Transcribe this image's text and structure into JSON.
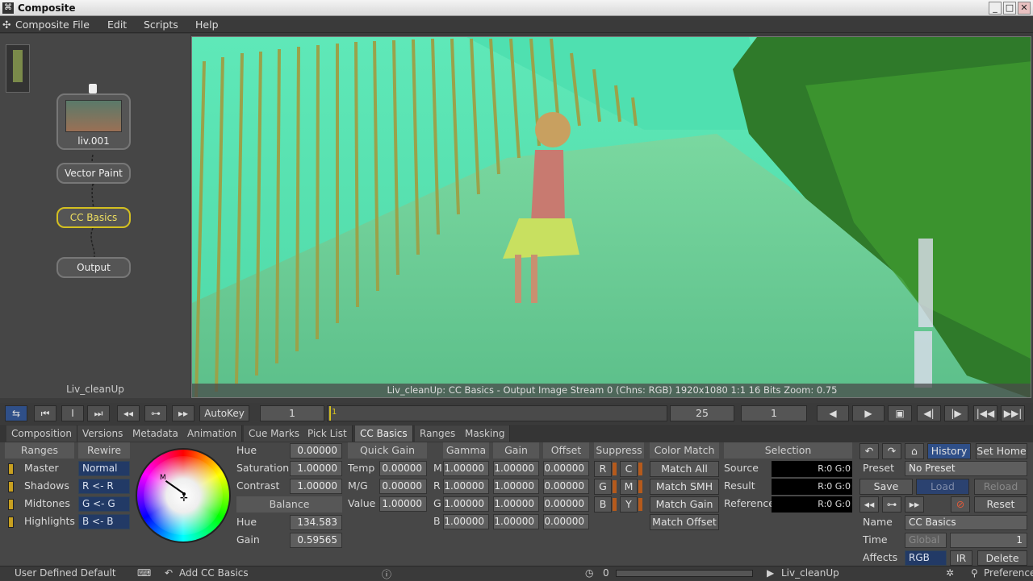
{
  "window": {
    "title": "Composite",
    "min": "_",
    "max": "□",
    "close": "✕"
  },
  "menu": {
    "app": "Composite",
    "items": [
      "File",
      "Edit",
      "Scripts",
      "Help"
    ]
  },
  "nodes": {
    "clip": "liv.001",
    "vector": "Vector Paint",
    "cc": "CC Basics",
    "output": "Output",
    "comp_name": "Liv_cleanUp"
  },
  "viewer": {
    "info": "Liv_cleanUp: CC Basics - Output Image  Stream 0 (Chns: RGB)  1920x1080  1:1  16 Bits  Zoom: 0.75"
  },
  "timeline": {
    "autokey": "AutoKey",
    "frame_start": "1",
    "marker": "1",
    "frame_end": "25",
    "current": "1"
  },
  "tabs": [
    "Composition",
    "Versions",
    "Metadata",
    "Animation",
    "Cue Marks",
    "Pick List",
    "CC Basics",
    "Ranges",
    "Masking"
  ],
  "cc": {
    "ranges_hdr": "Ranges",
    "rewire_hdr": "Rewire",
    "ranges": [
      {
        "name": "Master",
        "rewire": "Normal"
      },
      {
        "name": "Shadows",
        "rewire": "R <- R"
      },
      {
        "name": "Midtones",
        "rewire": "G <- G"
      },
      {
        "name": "Highlights",
        "rewire": "B <- B"
      }
    ],
    "hue_label": "Hue",
    "hue": "0.00000",
    "sat_label": "Saturation",
    "sat": "1.00000",
    "contrast_label": "Contrast",
    "contrast": "1.00000",
    "balance_hdr": "Balance",
    "bal_hue_label": "Hue",
    "bal_hue": "134.583",
    "bal_gain_label": "Gain",
    "bal_gain": "0.59565",
    "quick_gain_hdr": "Quick Gain",
    "temp_label": "Temp",
    "temp": "0.00000",
    "mg_label": "M/G",
    "mg": "0.00000",
    "value_label": "Value",
    "value": "1.00000",
    "gamma_hdr": "Gamma",
    "gain_hdr": "Gain",
    "offset_hdr": "Offset",
    "rows": [
      {
        "ch": "M",
        "gamma": "1.00000",
        "gain": "1.00000",
        "offset": "0.00000"
      },
      {
        "ch": "R",
        "gamma": "1.00000",
        "gain": "1.00000",
        "offset": "0.00000"
      },
      {
        "ch": "G",
        "gamma": "1.00000",
        "gain": "1.00000",
        "offset": "0.00000"
      },
      {
        "ch": "B",
        "gamma": "1.00000",
        "gain": "1.00000",
        "offset": "0.00000"
      }
    ],
    "suppress_hdr": "Suppress",
    "suppress": [
      [
        "R",
        "C"
      ],
      [
        "G",
        "M"
      ],
      [
        "B",
        "Y"
      ]
    ],
    "color_match_hdr": "Color Match",
    "match": [
      "Match All",
      "Match SMH",
      "Match Gain",
      "Match Offset"
    ],
    "selection_hdr": "Selection",
    "sel_labels": [
      "Source",
      "Result",
      "Reference"
    ],
    "sel_values": [
      "R:0 G:0",
      "R:0 G:0",
      "R:0 G:0"
    ],
    "wheel_marker": "M"
  },
  "right": {
    "history": "History",
    "set_home": "Set Home",
    "preset_label": "Preset",
    "preset": "No Preset",
    "save": "Save",
    "load": "Load",
    "reload": "Reload",
    "reset": "Reset",
    "name_label": "Name",
    "name": "CC Basics",
    "time_label": "Time",
    "time_mode": "Global",
    "time_val": "1",
    "affects_label": "Affects",
    "affects": "RGB",
    "ir": "IR",
    "delete": "Delete"
  },
  "status": {
    "left": "User Defined Default",
    "add": "Add CC Basics",
    "counter": "0",
    "comp": "Liv_cleanUp",
    "prefs": "Preferences"
  }
}
